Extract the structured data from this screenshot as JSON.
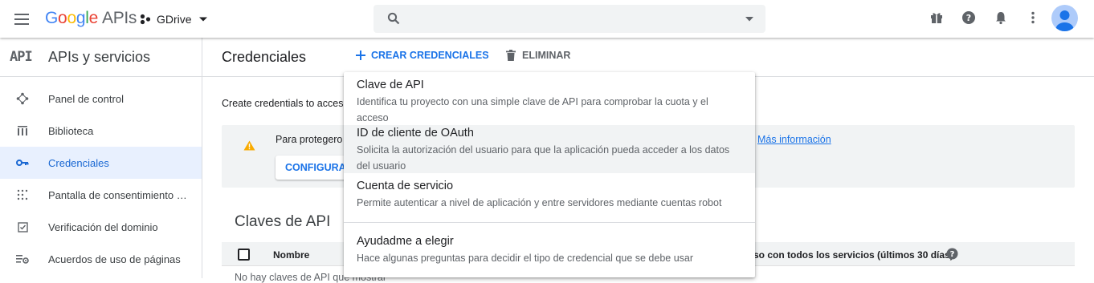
{
  "topbar": {
    "logo_google": [
      "G",
      "o",
      "o",
      "g",
      "l",
      "e"
    ],
    "logo_suffix": "APIs",
    "project_name": "GDrive",
    "search_placeholder": ""
  },
  "sidebar": {
    "logo_text": "API",
    "title": "APIs y servicios",
    "items": [
      {
        "label": "Panel de control",
        "icon": "dashboard-icon",
        "active": false
      },
      {
        "label": "Biblioteca",
        "icon": "library-icon",
        "active": false
      },
      {
        "label": "Credenciales",
        "icon": "key-icon",
        "active": true
      },
      {
        "label": "Pantalla de consentimiento …",
        "icon": "consent-icon",
        "active": false
      },
      {
        "label": "Verificación del dominio",
        "icon": "checkbox-icon",
        "active": false
      },
      {
        "label": "Acuerdos de uso de páginas",
        "icon": "settings-list-icon",
        "active": false
      }
    ]
  },
  "main": {
    "title": "Credenciales",
    "create_label": "CREAR CREDENCIALES",
    "delete_label": "ELIMINAR",
    "intro_text": "Create credentials to acces",
    "notice_text": "Para protegero",
    "notice_link": "Más información",
    "configure_label": "CONFIGURA",
    "section_title": "Claves de API",
    "table": {
      "col_name": "Nombre",
      "col_usage": "so con todos los servicios (últimos 30 días)"
    },
    "empty_text": "No hay claves de API que mostrar"
  },
  "menu": {
    "items": [
      {
        "title": "Clave de API",
        "desc": "Identifica tu proyecto con una simple clave de API para comprobar la cuota y el acceso"
      },
      {
        "title": "ID de cliente de OAuth",
        "desc": "Solicita la autorización del usuario para que la aplicación pueda acceder a los datos del usuario"
      },
      {
        "title": "Cuenta de servicio",
        "desc": "Permite autenticar a nivel de aplicación y entre servidores mediante cuentas robot"
      },
      {
        "title": "Ayudadme a elegir",
        "desc": "Hace algunas preguntas para decidir el tipo de credencial que se debe usar"
      }
    ]
  },
  "colors": {
    "accent": "#1a73e8",
    "active_bg": "#e8f0fe",
    "warning": "#f9ab00"
  }
}
